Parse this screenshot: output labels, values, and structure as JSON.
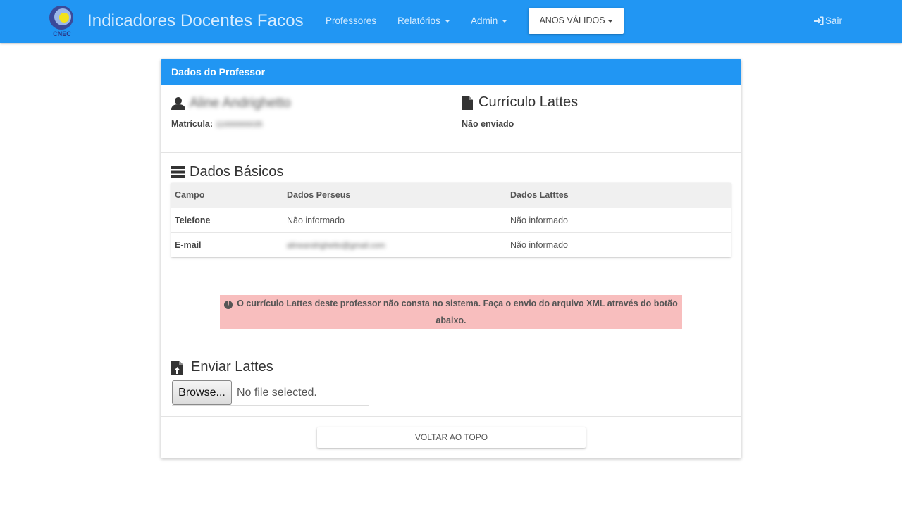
{
  "navbar": {
    "logo_text": "CNEC",
    "brand_title": "Indicadores Docentes Facos",
    "links": {
      "professores": "Professores",
      "relatorios": "Relatórios",
      "admin": "Admin"
    },
    "years_button": "ANOS VÁLIDOS",
    "logout": "Sair"
  },
  "panel": {
    "heading": "Dados do Professor",
    "professor": {
      "name": "Aline Andrighetto",
      "matricula_label": "Matrícula:",
      "matricula_value": "11000000035"
    },
    "lattes": {
      "title": "Currículo Lattes",
      "status": "Não enviado"
    },
    "basic": {
      "title": "Dados Básicos",
      "columns": [
        "Campo",
        "Dados Perseus",
        "Dados Latttes"
      ],
      "rows": [
        [
          "Telefone",
          "Não informado",
          "Não informado"
        ],
        [
          "E-mail",
          "alineandrighetto@gmail.com",
          "Não informado"
        ]
      ]
    },
    "alert": "O currículo Lattes deste professor não consta no sistema. Faça o envio do arquivo XML através do botão abaixo.",
    "upload": {
      "title": "Enviar Lattes",
      "browse_label": "Browse...",
      "file_status": "No file selected."
    },
    "back_to_top": "VOLTAR AO TOPO"
  },
  "colors": {
    "primary": "#2196f3",
    "alert_bg": "#f8bebe"
  }
}
